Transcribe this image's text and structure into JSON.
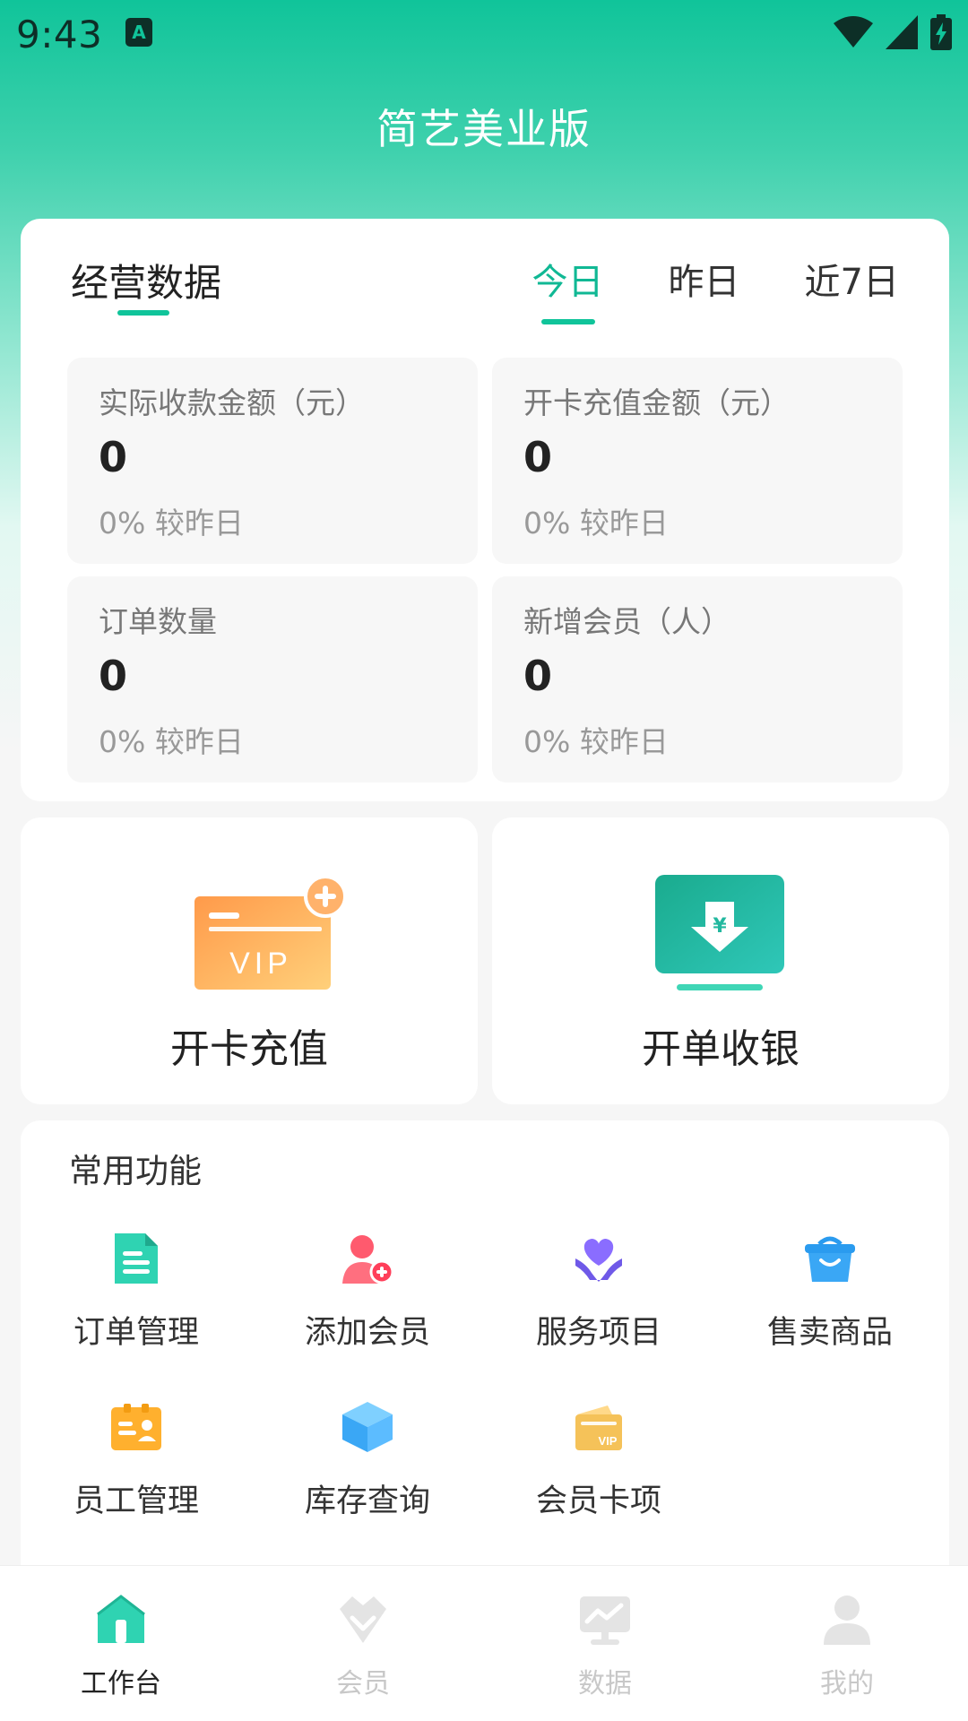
{
  "status_bar": {
    "time": "9:43",
    "notif_glyph": "A"
  },
  "app": {
    "title": "简艺美业版"
  },
  "stats": {
    "title": "经营数据",
    "tabs": [
      {
        "label": "今日",
        "active": true
      },
      {
        "label": "昨日",
        "active": false
      },
      {
        "label": "近7日",
        "active": false
      }
    ],
    "tiles": [
      {
        "label": "实际收款金额（元）",
        "value": "0",
        "compare": "0% 较昨日"
      },
      {
        "label": "开卡充值金额（元）",
        "value": "0",
        "compare": "0% 较昨日"
      },
      {
        "label": "订单数量",
        "value": "0",
        "compare": "0% 较昨日"
      },
      {
        "label": "新增会员（人）",
        "value": "0",
        "compare": "0% 较昨日"
      }
    ]
  },
  "actions": {
    "open_card": {
      "label": "开卡充值",
      "icon": "vip-card-add-icon",
      "badge_text": "VIP"
    },
    "checkout": {
      "label": "开单收银",
      "icon": "cashier-icon",
      "symbol": "¥"
    }
  },
  "functions": {
    "title": "常用功能",
    "items": [
      {
        "label": "订单管理",
        "icon": "order-document-icon"
      },
      {
        "label": "添加会员",
        "icon": "add-member-icon"
      },
      {
        "label": "服务项目",
        "icon": "service-heart-hand-icon"
      },
      {
        "label": "售卖商品",
        "icon": "shopping-bag-icon"
      },
      {
        "label": "员工管理",
        "icon": "staff-badge-icon"
      },
      {
        "label": "库存查询",
        "icon": "inventory-box-icon"
      },
      {
        "label": "会员卡项",
        "icon": "vip-card-icon",
        "badge_text": "VIP"
      }
    ]
  },
  "bottom_nav": {
    "items": [
      {
        "label": "工作台",
        "icon": "home-icon",
        "active": true
      },
      {
        "label": "会员",
        "icon": "member-crown-icon",
        "active": false
      },
      {
        "label": "数据",
        "icon": "data-monitor-icon",
        "active": false
      },
      {
        "label": "我的",
        "icon": "profile-icon",
        "active": false
      }
    ]
  },
  "colors": {
    "brand": "#10c49a",
    "active_tab": "#10b894",
    "text_dark": "#222222",
    "text_muted": "#999999",
    "nav_inactive": "#c8c8c8"
  }
}
